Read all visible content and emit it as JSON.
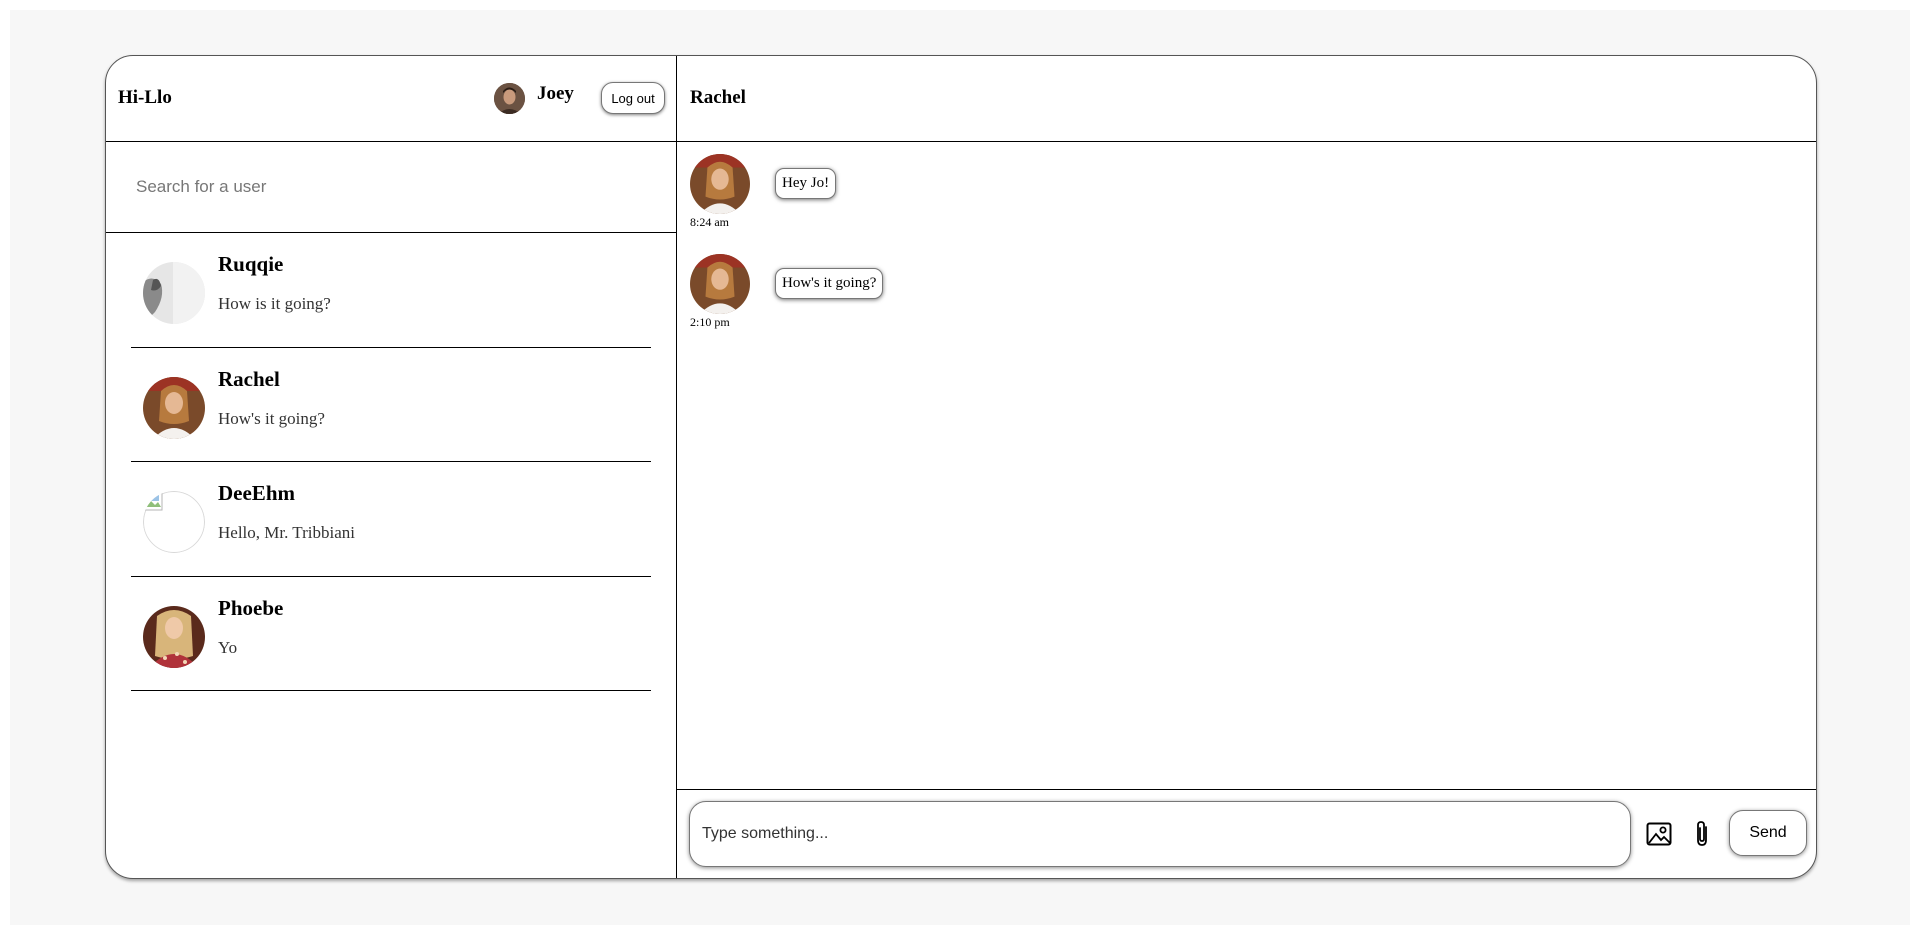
{
  "app": {
    "brand": "Hi-Llo"
  },
  "current_user": {
    "name": "Joey",
    "logout_label": "Log out"
  },
  "search": {
    "placeholder": "Search for a user",
    "value": ""
  },
  "conversations": [
    {
      "name": "Ruqqie",
      "preview": "How is it going?",
      "avatar": "grey-photo-avatar"
    },
    {
      "name": "Rachel",
      "preview": "How's it going?",
      "avatar": "rachel-photo-avatar"
    },
    {
      "name": "DeeEhm",
      "preview": "Hello, Mr. Tribbiani",
      "avatar": "broken-image-avatar"
    },
    {
      "name": "Phoebe",
      "preview": "Yo",
      "avatar": "phoebe-photo-avatar"
    }
  ],
  "chat": {
    "title": "Rachel",
    "messages": [
      {
        "text": "Hey Jo!",
        "time": "8:24 am"
      },
      {
        "text": "How's it going?",
        "time": "2:10 pm"
      }
    ]
  },
  "composer": {
    "placeholder": "Type something...",
    "value": "",
    "image_icon": "image-icon",
    "attach_icon": "paperclip-icon",
    "send_label": "Send"
  }
}
